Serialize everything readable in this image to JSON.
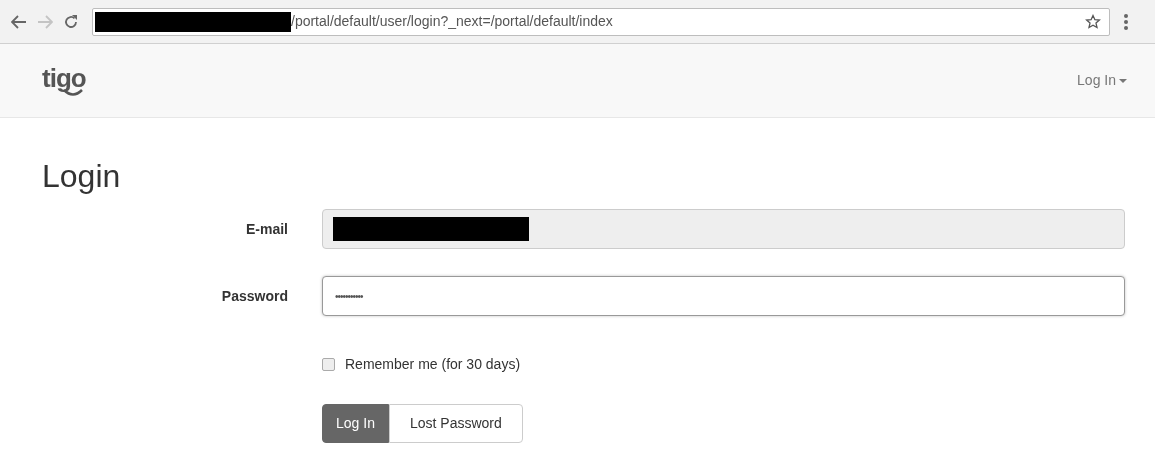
{
  "browser": {
    "address": "/portal/default/user/login?_next=/portal/default/index",
    "address_redacted": true
  },
  "navbar": {
    "logo": "tigo",
    "menu": "Log In"
  },
  "heading": "Login",
  "fields": [
    {
      "label": "E-mail",
      "value_redacted": true,
      "disabled": true,
      "focused": false
    },
    {
      "label": "Password",
      "value": "•••••••••••",
      "disabled": false,
      "focused": true
    }
  ],
  "remember": {
    "label": "Remember me (for 30 days)",
    "checked": false
  },
  "buttons": [
    {
      "label": "Log In",
      "primary": true
    },
    {
      "label": "Lost Password",
      "primary": false
    }
  ]
}
